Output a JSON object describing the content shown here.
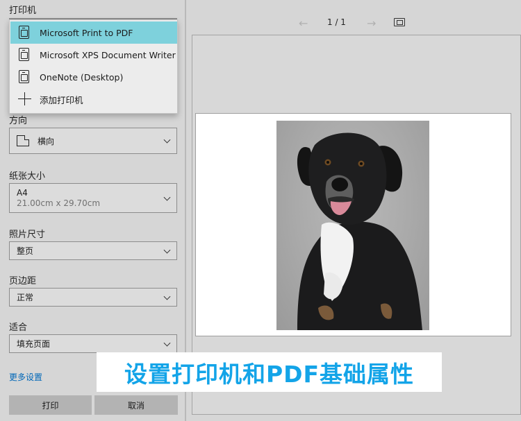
{
  "printer": {
    "section_label": "打印机",
    "options": [
      {
        "label": "Microsoft Print to PDF",
        "icon": "printer-icon",
        "selected": true
      },
      {
        "label": "Microsoft XPS Document Writer",
        "icon": "printer-icon",
        "selected": false
      },
      {
        "label": "OneNote (Desktop)",
        "icon": "printer-icon",
        "selected": false
      },
      {
        "label": "添加打印机",
        "icon": "plus-icon",
        "selected": false
      }
    ]
  },
  "orientation": {
    "label": "方向",
    "value": "横向",
    "icon": "landscape-page-icon"
  },
  "paper_size": {
    "label": "纸张大小",
    "value": "A4",
    "detail": "21.00cm x 29.70cm"
  },
  "photo_size": {
    "label": "照片尺寸",
    "value": "整页"
  },
  "margins": {
    "label": "页边距",
    "value": "正常"
  },
  "fit": {
    "label": "适合",
    "value": "填充页面"
  },
  "more_settings": "更多设置",
  "buttons": {
    "print": "打印",
    "cancel": "取消"
  },
  "preview": {
    "page_indicator": "1 / 1",
    "prev_icon": "arrow-left-icon",
    "next_icon": "arrow-right-icon",
    "fit_icon": "fit-to-window-icon",
    "image_subject": "black-and-white-dog-photo"
  },
  "overlay_caption": "设置打印机和PDF基础属性",
  "colors": {
    "selection": "#7ed1dc",
    "link": "#0067b8",
    "caption": "#13a4e8",
    "background": "#d6d6d6",
    "button": "#b3b3b3"
  }
}
